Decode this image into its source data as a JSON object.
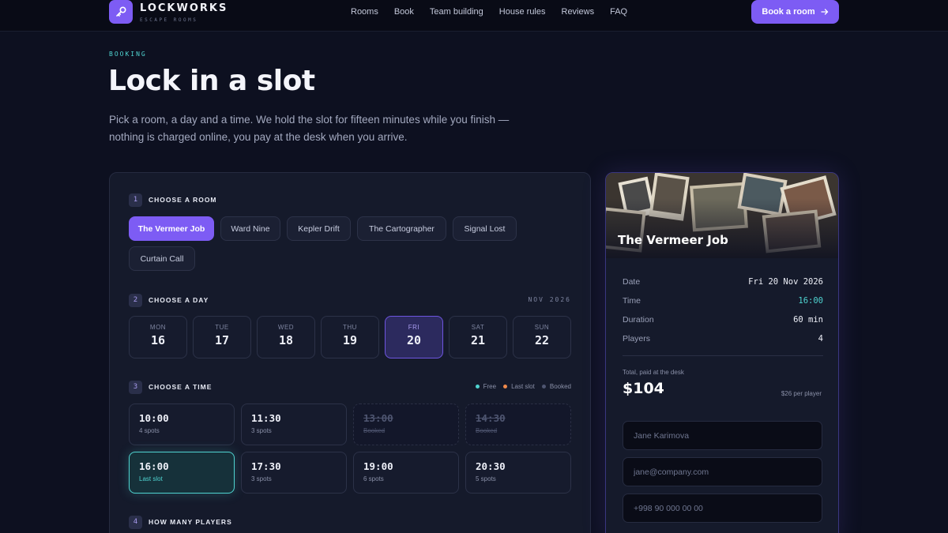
{
  "brand": {
    "name": "LOCKWORKS",
    "sub": "ESCAPE ROOMS"
  },
  "nav": {
    "links": [
      "Rooms",
      "Book",
      "Team building",
      "House rules",
      "Reviews",
      "FAQ"
    ],
    "cta": "Book a room"
  },
  "hero": {
    "eyebrow": "BOOKING",
    "title": "Lock in a slot",
    "intro": "Pick a room, a day and a time. We hold the slot for fifteen minutes while you finish — nothing is charged online, you pay at the desk when you arrive."
  },
  "steps": {
    "room": {
      "num": "1",
      "label": "CHOOSE A ROOM"
    },
    "day": {
      "num": "2",
      "label": "CHOOSE A DAY",
      "month": "NOV 2026"
    },
    "time": {
      "num": "3",
      "label": "CHOOSE A TIME"
    },
    "players": {
      "num": "4",
      "label": "HOW MANY PLAYERS"
    }
  },
  "rooms": [
    "The Vermeer Job",
    "Ward Nine",
    "Kepler Drift",
    "The Cartographer",
    "Signal Lost",
    "Curtain Call"
  ],
  "selected_room": "The Vermeer Job",
  "days": [
    {
      "name": "MON",
      "num": "16"
    },
    {
      "name": "TUE",
      "num": "17"
    },
    {
      "name": "WED",
      "num": "18"
    },
    {
      "name": "THU",
      "num": "19"
    },
    {
      "name": "FRI",
      "num": "20"
    },
    {
      "name": "SAT",
      "num": "21"
    },
    {
      "name": "SUN",
      "num": "22"
    }
  ],
  "selected_day": "20",
  "legend": [
    {
      "label": "Free",
      "color": "#4fd3d0"
    },
    {
      "label": "Last slot",
      "color": "#f08a4b"
    },
    {
      "label": "Booked",
      "color": "#4e5570"
    }
  ],
  "times": [
    {
      "time": "10:00",
      "status": "4 spots",
      "state": "free"
    },
    {
      "time": "11:30",
      "status": "3 spots",
      "state": "free"
    },
    {
      "time": "13:00",
      "status": "Booked",
      "state": "booked"
    },
    {
      "time": "14:30",
      "status": "Booked",
      "state": "booked"
    },
    {
      "time": "16:00",
      "status": "Last slot",
      "state": "selected"
    },
    {
      "time": "17:30",
      "status": "3 spots",
      "state": "free"
    },
    {
      "time": "19:00",
      "status": "6 spots",
      "state": "free"
    },
    {
      "time": "20:30",
      "status": "5 spots",
      "state": "free"
    }
  ],
  "summary": {
    "room": "The Vermeer Job",
    "rows": [
      {
        "key": "Date",
        "value": "Fri 20 Nov 2026"
      },
      {
        "key": "Time",
        "value": "16:00"
      },
      {
        "key": "Duration",
        "value": "60 min"
      },
      {
        "key": "Players",
        "value": "4"
      }
    ],
    "total_label": "Total, paid at the desk",
    "total": "$104",
    "per_player": "$26 per player",
    "fields": {
      "name_placeholder": "Jane Karimova",
      "email_placeholder": "jane@company.com",
      "phone_placeholder": "+998 90 000 00 00"
    }
  },
  "colors": {
    "accent": "#7d5cf4",
    "teal": "#4fd3d0",
    "background": "#0d1020"
  }
}
